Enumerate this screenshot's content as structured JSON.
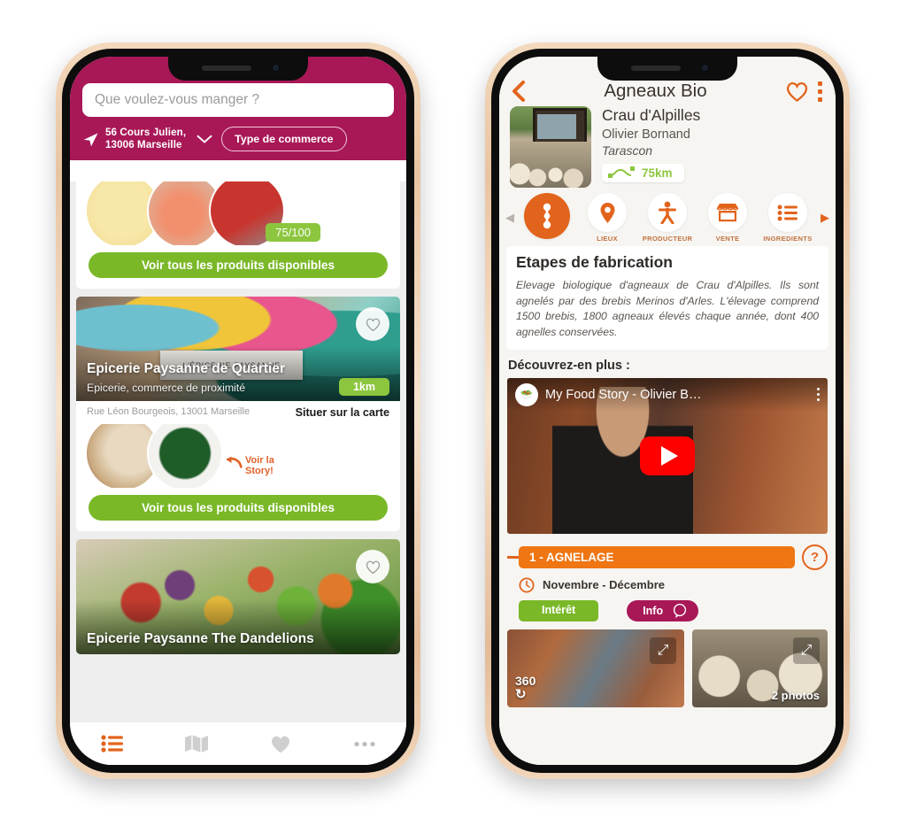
{
  "left_phone": {
    "search": {
      "placeholder": "Que voulez-vous manger ?"
    },
    "location": {
      "line1": "56 Cours Julien,",
      "line2": "13006 Marseille"
    },
    "type_button": "Type de commerce",
    "cards": [
      {
        "score_badge": "75/100",
        "products_button": "Voir tous les produits disponibles"
      },
      {
        "title": "Epicerie Paysanne de Quartier",
        "subtitle": "Epicerie, commerce de proximité",
        "distance": "1km",
        "address": "Rue Léon Bourgeois, 13001 Marseille",
        "map_link": "Situer sur la carte",
        "story_line1": "Voir la",
        "story_line2": "Story!",
        "products_button": "Voir tous les produits disponibles"
      },
      {
        "title": "Epicerie Paysanne The Dandelions"
      }
    ],
    "nav": [
      {
        "icon": "list-icon",
        "active": true
      },
      {
        "icon": "map-icon",
        "active": false
      },
      {
        "icon": "heart-icon",
        "active": false
      },
      {
        "icon": "more-icon",
        "active": false
      }
    ]
  },
  "right_phone": {
    "header": {
      "title": "Agneaux Bio",
      "back": "back-icon",
      "favorite": "heart-icon",
      "menu": "kebab-menu-icon"
    },
    "product": {
      "farm": "Crau d'Alpilles",
      "producer": "Olivier Bornand",
      "city": "Tarascon",
      "distance": "75km"
    },
    "tabs": [
      {
        "label": "",
        "icon": "steps-icon",
        "active": true
      },
      {
        "label": "LIEUX",
        "icon": "map-pin-icon",
        "active": false
      },
      {
        "label": "PRODUCTEUR",
        "icon": "person-icon",
        "active": false
      },
      {
        "label": "VENTE",
        "icon": "shop-icon",
        "active": false
      },
      {
        "label": "INGREDIENTS",
        "icon": "list-icon",
        "active": false
      }
    ],
    "section": {
      "heading": "Etapes de fabrication",
      "description": "Elevage biologique d'agneaux de Crau d'Alpilles. Ils sont agnelés par des brebis Merinos d'Arles. L'élevage comprend 1500 brebis, 1800 agneaux élevés chaque année, dont 400 agnelles conservées.",
      "discover_label": "Découvrez-en plus :"
    },
    "video": {
      "title": "My Food Story - Olivier B…",
      "menu": "kebab-menu-icon",
      "play": "play-button"
    },
    "step": {
      "title": "1 - AGNELAGE",
      "help": "?",
      "period": "Novembre - Décembre",
      "chip_interest": "Intérêt",
      "chip_info": "Info"
    },
    "photos": [
      {
        "badge": "360",
        "expand": "expand-icon"
      },
      {
        "badge": "2 photos",
        "expand": "expand-icon"
      }
    ]
  },
  "colors": {
    "magenta": "#a81857",
    "orange": "#e2641c",
    "orange_light": "#ef7612",
    "green": "#7ab828",
    "green_light": "#8cc63e",
    "youtube_red": "#ff0000"
  }
}
